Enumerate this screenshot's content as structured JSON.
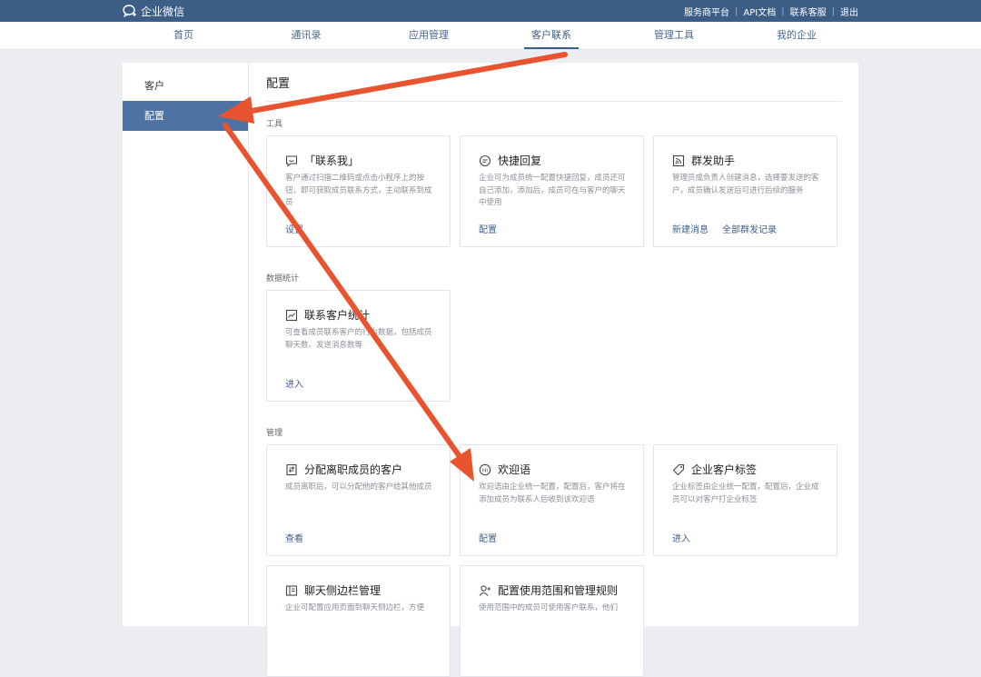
{
  "topbar": {
    "brand": "企业微信",
    "links": [
      "服务商平台",
      "API文档",
      "联系客服",
      "退出"
    ]
  },
  "nav": {
    "items": [
      "首页",
      "通讯录",
      "应用管理",
      "客户联系",
      "管理工具",
      "我的企业"
    ],
    "active": "客户联系"
  },
  "sidebar": {
    "items": [
      "客户",
      "配置"
    ],
    "active": "配置"
  },
  "page": {
    "title": "配置",
    "sections": {
      "tools": "工具",
      "stats": "数据统计",
      "manage": "管理"
    }
  },
  "cards": {
    "contact_me": {
      "icon": "chat-bubble-icon",
      "title": "「联系我」",
      "desc": "客户通过扫描二维码或点击小程序上的按钮，即可获取成员联系方式，主动联系到成员",
      "actions": [
        "设置"
      ]
    },
    "quick_reply": {
      "icon": "message-lines-icon",
      "title": "快捷回复",
      "desc": "企业可为成员统一配置快捷回复，成员还可自己添加，添加后，成员可在与客户的聊天中使用",
      "actions": [
        "配置"
      ]
    },
    "broadcast": {
      "icon": "broadcast-icon",
      "title": "群发助手",
      "desc": "管理员或负责人创建消息，选择要发送的客户，成员确认发送后可进行后续的服务",
      "actions": [
        "新建消息",
        "全部群发记录"
      ]
    },
    "stats": {
      "icon": "line-chart-icon",
      "title": "联系客户统计",
      "desc": "可查看成员联系客户的行为数据，包括成员聊天数、发送消息数等",
      "actions": [
        "进入"
      ]
    },
    "transfer": {
      "icon": "transfer-doc-icon",
      "title": "分配离职成员的客户",
      "desc": "成员离职后，可以分配他的客户给其他成员",
      "actions": [
        "查看"
      ]
    },
    "welcome": {
      "icon": "hi-icon",
      "title": "欢迎语",
      "desc": "欢迎语由企业统一配置，配置后，客户将在添加成员为联系人后收到该欢迎语",
      "actions": [
        "配置"
      ]
    },
    "tags": {
      "icon": "tag-icon",
      "title": "企业客户标签",
      "desc": "企业标签由企业统一配置，配置后，企业成员可以对客户打企业标签",
      "actions": [
        "进入"
      ]
    },
    "sidebar_mgmt": {
      "icon": "sidebar-panel-icon",
      "title": "聊天侧边栏管理",
      "desc": "企业可配置应用页面到聊天侧边栏，方便",
      "actions": []
    },
    "scope": {
      "icon": "user-plus-icon",
      "title": "配置使用范围和管理规则",
      "desc": "使用范围中的成员可使用客户联系，他们",
      "actions": []
    }
  },
  "colors": {
    "topbar": "#3b5d86",
    "accent": "#4f72a4",
    "link": "#3e5f8c",
    "annotation_arrow": "#e8542f"
  }
}
